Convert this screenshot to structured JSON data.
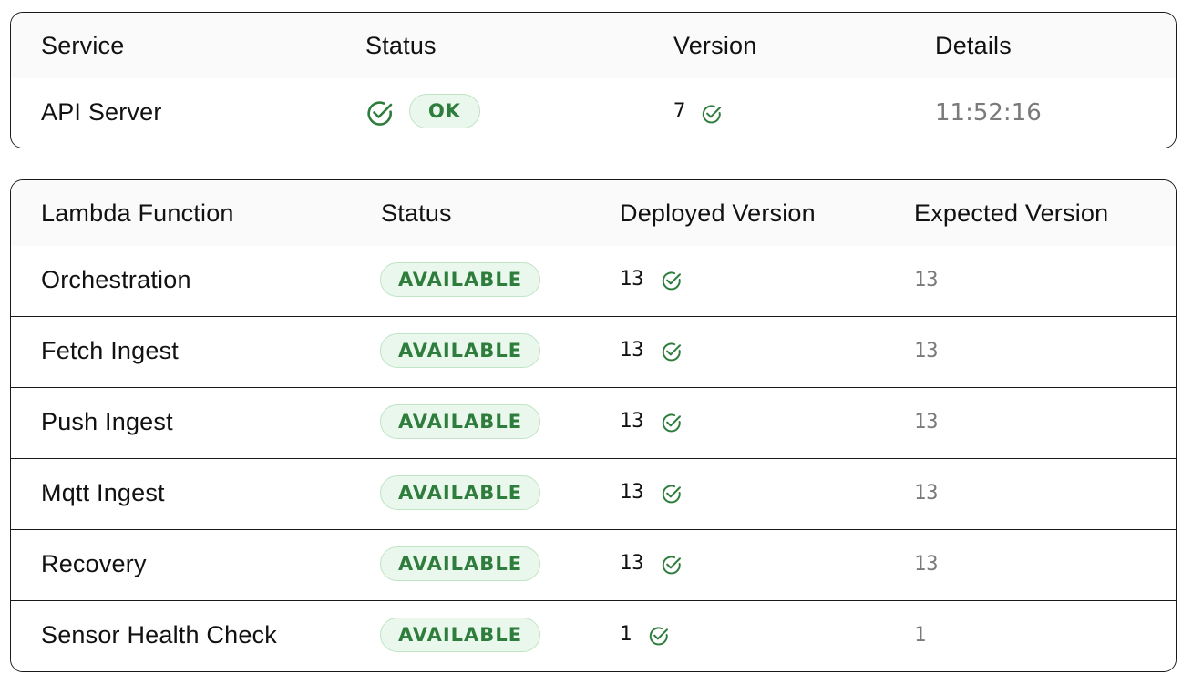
{
  "service_table": {
    "headers": [
      "Service",
      "Status",
      "Version",
      "Details"
    ],
    "row": {
      "service": "API Server",
      "status_icon": "check-circle-icon",
      "status": "OK",
      "version": "7",
      "version_icon": "check-circle-icon",
      "details": "11:52:16"
    }
  },
  "lambda_table": {
    "headers": [
      "Lambda Function",
      "Status",
      "Deployed Version",
      "Expected Version"
    ],
    "rows": [
      {
        "name": "Orchestration",
        "status": "AVAILABLE",
        "deployed": "13",
        "expected": "13"
      },
      {
        "name": "Fetch Ingest",
        "status": "AVAILABLE",
        "deployed": "13",
        "expected": "13"
      },
      {
        "name": "Push Ingest",
        "status": "AVAILABLE",
        "deployed": "13",
        "expected": "13"
      },
      {
        "name": "Mqtt Ingest",
        "status": "AVAILABLE",
        "deployed": "13",
        "expected": "13"
      },
      {
        "name": "Recovery",
        "status": "AVAILABLE",
        "deployed": "13",
        "expected": "13"
      },
      {
        "name": "Sensor Health Check",
        "status": "AVAILABLE",
        "deployed": "1",
        "expected": "1"
      }
    ]
  },
  "colors": {
    "accent_green": "#2e7d3c",
    "pill_bg": "#eaf7ec",
    "pill_border": "#bfe4c6",
    "muted_text": "#7a7a7a"
  }
}
